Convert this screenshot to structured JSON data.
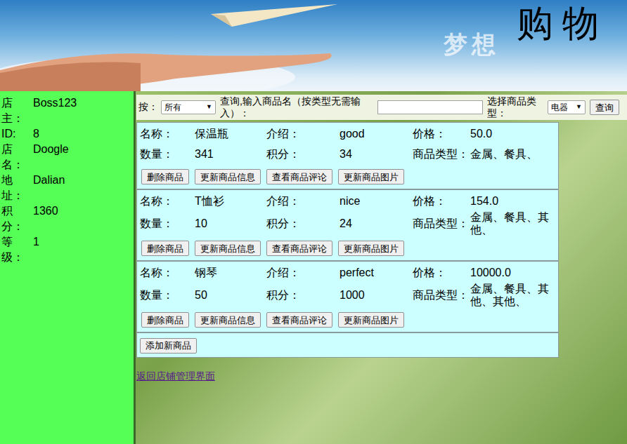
{
  "banner": {
    "subtitle": "梦想",
    "title": "购 物"
  },
  "owner": [
    {
      "label": "店主：",
      "value": "Boss123"
    },
    {
      "label": "ID:",
      "value": "8"
    },
    {
      "label": "店名：",
      "value": "Doogle"
    },
    {
      "label": "地址：",
      "value": "Dalian"
    },
    {
      "label": "积分：",
      "value": "1360"
    },
    {
      "label": "等级：",
      "value": "1"
    }
  ],
  "search": {
    "by_label": "按：",
    "by_select": "所有",
    "query_label": "查询,输入商品名（按类型无需输入）：",
    "query_value": "",
    "type_label": "选择商品类型：",
    "type_select": "电器",
    "dropdown_arrow": "▼",
    "button": "查询"
  },
  "field_labels": {
    "name": "名称：",
    "intro": "介绍：",
    "price": "价格：",
    "count": "数量：",
    "points": "积分：",
    "type": "商品类型："
  },
  "product_buttons": [
    "删除商品",
    "更新商品信息",
    "查看商品评论",
    "更新商品图片"
  ],
  "products": [
    {
      "name": "保温瓶",
      "intro": "good",
      "price": "50.0",
      "count": "341",
      "points": "34",
      "type": "金属、餐具、"
    },
    {
      "name": "T恤衫",
      "intro": "nice",
      "price": "154.0",
      "count": "10",
      "points": "24",
      "type": "金属、餐具、其他、"
    },
    {
      "name": "钢琴",
      "intro": "perfect",
      "price": "10000.0",
      "count": "50",
      "points": "1000",
      "type": "金属、餐具、其他、其他、"
    }
  ],
  "add_button": "添加新商品",
  "back_link": "返回店铺管理界面"
}
